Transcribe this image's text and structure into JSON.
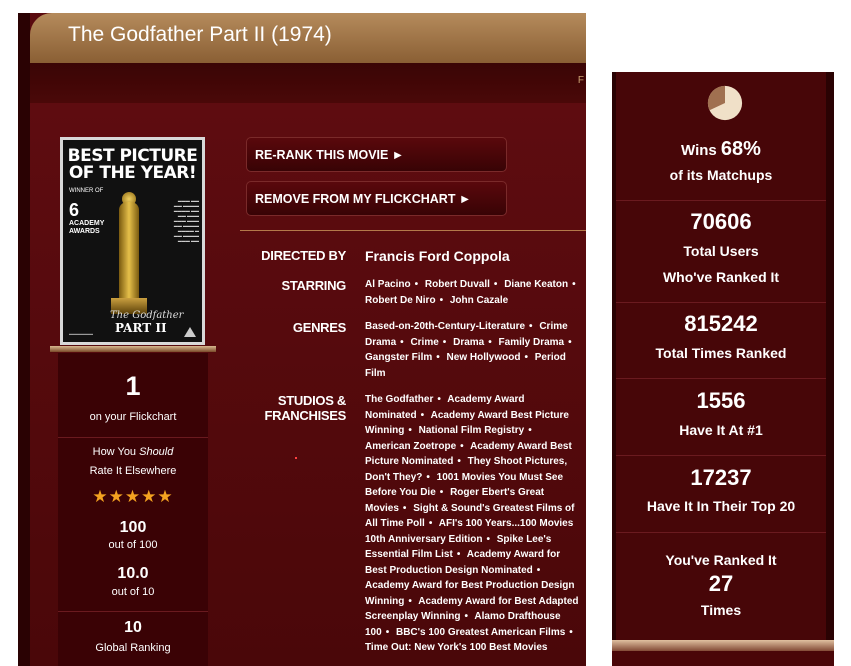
{
  "movie": {
    "title": "The Godfather Part II (1974)",
    "subnav_edge": "F"
  },
  "poster": {
    "headline": "BEST PICTURE OF THE YEAR!",
    "winner_of": "WINNER OF",
    "award_count": "6",
    "awards_label": "ACADEMY AWARDS",
    "logo_top": "The Godfather",
    "logo_bottom": "PART II"
  },
  "actions": {
    "rerank": "RE-RANK THIS MOVIE ►",
    "remove": "REMOVE FROM MY FLICKCHART ►"
  },
  "rank_box": {
    "rank": "1",
    "rank_label": "on your Flickchart",
    "should_rate_prefix": "How You ",
    "should_rate_em": "Should",
    "should_rate_suffix": "Rate It Elsewhere",
    "stars": "★★★★★",
    "star_rating": 5,
    "score_100": "100",
    "score_100_label": "out of 100",
    "score_10": "10.0",
    "score_10_label": "out of 10",
    "global_rank": "10",
    "global_rank_label": "Global Ranking"
  },
  "info": {
    "directed_by_label": "DIRECTED BY",
    "director": "Francis Ford Coppola",
    "starring_label": "STARRING",
    "stars": [
      "Al Pacino",
      "Robert Duvall",
      "Diane Keaton",
      "Robert De Niro",
      "John Cazale"
    ],
    "genres_label": "GENRES",
    "genres": [
      "Based-on-20th-Century-Literature",
      "Crime Drama",
      "Crime",
      "Drama",
      "Family Drama",
      "Gangster Film",
      "New Hollywood",
      "Period Film"
    ],
    "studios_label_1": "STUDIOS &",
    "studios_label_2": "FRANCHISES",
    "franchises": [
      "The Godfather",
      "Academy Award Nominated",
      "Academy Award Best Picture Winning",
      "National Film Registry",
      "American Zoetrope",
      "Academy Award Best Picture Nominated",
      "They Shoot Pictures, Don't They?",
      "1001 Movies You Must See Before You Die",
      "Roger Ebert's Great Movies",
      "Sight & Sound's Greatest Films of All Time Poll",
      "AFI's 100 Years...100 Movies 10th Anniversary Edition",
      "Spike Lee's Essential Film List",
      "Academy Award for Best Production Design Nominated",
      "Academy Award for Best Production Design Winning",
      "Academy Award for Best Adapted Screenplay Winning",
      "Alamo Drafthouse 100",
      "BBC's 100 Greatest American Films",
      "Time Out: New York's 100 Best Movies"
    ]
  },
  "stats": {
    "win_pct_fraction": 0.68,
    "wins_prefix": "Wins ",
    "wins_pct": "68%",
    "wins_suffix": "of its Matchups",
    "total_users": "70606",
    "total_users_label_1": "Total Users",
    "total_users_label_2": "Who've Ranked It",
    "total_times": "815242",
    "total_times_label": "Total Times Ranked",
    "at_one": "1556",
    "at_one_label": "Have It At #1",
    "top20": "17237",
    "top20_label": "Have It In Their Top 20",
    "you_ranked_label": "You've Ranked It",
    "you_ranked": "27",
    "you_ranked_suffix": "Times"
  },
  "colors": {
    "panel": "#5a0a0f",
    "box": "#3a0205",
    "accent_tan": "#b58b5c",
    "star": "#f4a220",
    "pie_fill": "#f0e0c8",
    "pie_slice": "#a07050"
  }
}
